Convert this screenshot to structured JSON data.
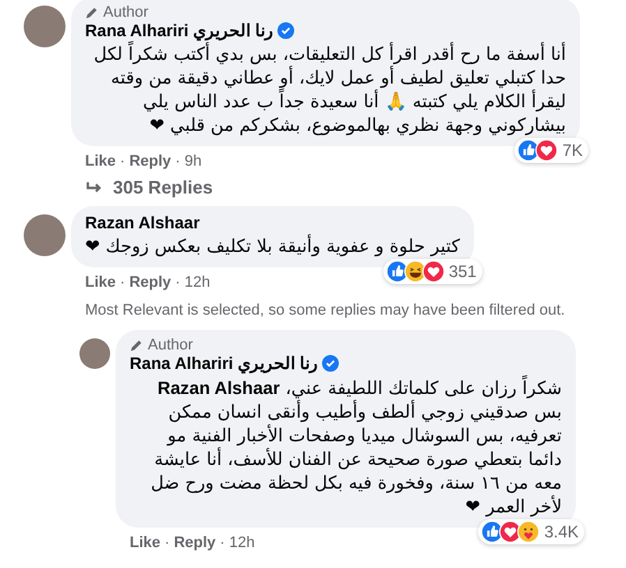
{
  "comments": [
    {
      "author_label": "Author",
      "name": "Rana Alhariri رنا الحريري",
      "verified": true,
      "text": "أنا أسفة ما رح أقدر اقرأ كل التعليقات، بس بدي أكتب شكراً لكل حدا كتبلي تعليق لطيف أو عمل لايك، أو عطاني دقيقة من وقته ليقرأ الكلام يلي كتبته 🙏 أنا سعيدة جداً ب عدد الناس يلي بيشاركوني وجهة نظري بهالموضوع، بشكركم من قلبي ❤",
      "reactions": [
        {
          "kind": "like"
        },
        {
          "kind": "love"
        }
      ],
      "reaction_count": "7K",
      "like": "Like",
      "separator": "·",
      "reply": "Reply",
      "time": "9h",
      "replies_link": "305 Replies"
    },
    {
      "name": "Razan Alshaar",
      "text": "كتير حلوة و عفوية وأنيقة بلا تكليف بعكس زوجك ❤",
      "reactions": [
        {
          "kind": "like"
        },
        {
          "kind": "haha"
        },
        {
          "kind": "love"
        }
      ],
      "reaction_count": "351",
      "like": "Like",
      "separator": "·",
      "reply": "Reply",
      "time": "12h",
      "notice": "Most Relevant is selected, so some replies may have been filtered out.",
      "replies": [
        {
          "author_label": "Author",
          "name": "Rana Alhariri رنا الحريري",
          "verified": true,
          "text": "شكراً رزان على كلماتك اللطيفة عني، **Razan Alshaar** بس صدقيني زوجي ألطف وأطيب وأنقى انسان ممكن تعرفيه، بس السوشال ميديا وصفحات الأخبار الفنية مو دائما بتعطي صورة صحيحة عن الفنان للأسف، أنا عايشة معه من ١٦ سنة، وفخورة فيه بكل لحظة مضت ورح ضل لأخر العمر ❤",
          "reactions": [
            {
              "kind": "like"
            },
            {
              "kind": "love"
            },
            {
              "kind": "care"
            }
          ],
          "reaction_count": "3.4K",
          "like": "Like",
          "separator": "·",
          "reply": "Reply",
          "time": "12h"
        }
      ]
    }
  ]
}
